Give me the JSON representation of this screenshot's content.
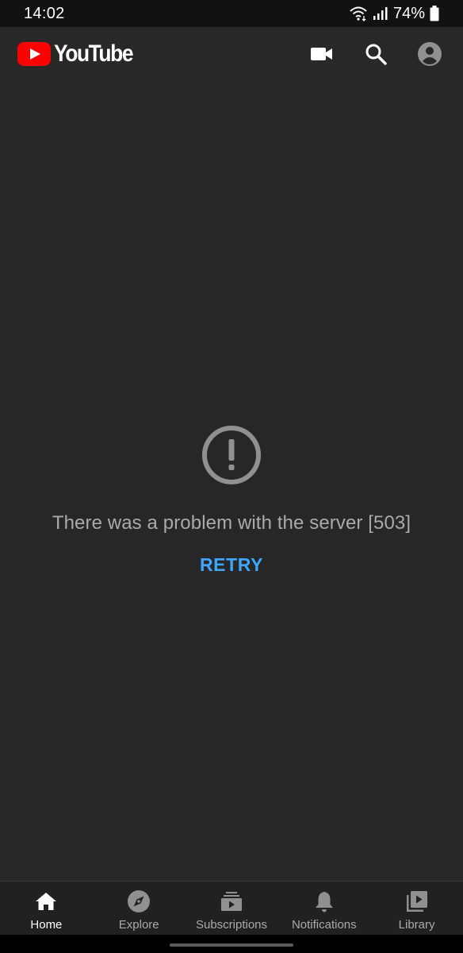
{
  "status_bar": {
    "time": "14:02",
    "battery_text": "74%",
    "icons": [
      "wifi-icon",
      "signal-icon",
      "battery-icon"
    ]
  },
  "header": {
    "logo_text": "YouTube",
    "brand_color": "#ff0000",
    "actions": [
      "camera-icon",
      "search-icon",
      "account-icon"
    ]
  },
  "error": {
    "icon": "error-icon",
    "message": "There was a problem with the server [503]",
    "retry_label": "RETRY",
    "accent_color": "#3ea6ff"
  },
  "bottom_nav": {
    "active": "Home",
    "items": [
      {
        "label": "Home",
        "icon": "home-icon"
      },
      {
        "label": "Explore",
        "icon": "compass-icon"
      },
      {
        "label": "Subscriptions",
        "icon": "subscriptions-icon"
      },
      {
        "label": "Notifications",
        "icon": "bell-icon"
      },
      {
        "label": "Library",
        "icon": "library-icon"
      }
    ]
  }
}
